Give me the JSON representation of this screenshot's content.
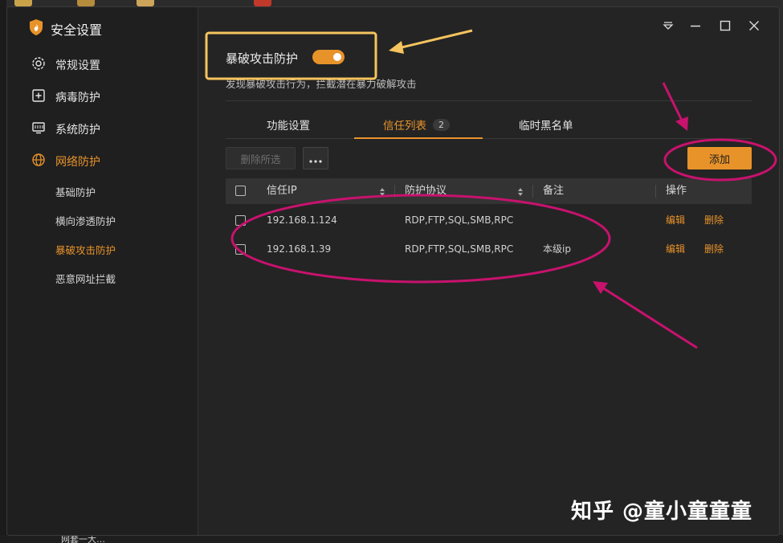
{
  "app": {
    "title": "安全设置"
  },
  "sidebar": {
    "items": [
      {
        "label": "常规设置",
        "icon": "gear-icon"
      },
      {
        "label": "病毒防护",
        "icon": "plus-square-icon"
      },
      {
        "label": "系统防护",
        "icon": "system-monitor-icon"
      },
      {
        "label": "网络防护",
        "icon": "globe-icon"
      }
    ],
    "subitems": [
      {
        "label": "基础防护"
      },
      {
        "label": "横向渗透防护"
      },
      {
        "label": "暴破攻击防护"
      },
      {
        "label": "恶意网址拦截"
      }
    ],
    "active_item": "网络防护",
    "active_subitem": "暴破攻击防护"
  },
  "feature": {
    "title": "暴破攻击防护",
    "description": "发现暴破攻击行为，拦截潜在暴力破解攻击",
    "enabled": true
  },
  "tabs": [
    {
      "label": "功能设置"
    },
    {
      "label": "信任列表",
      "badge": "2"
    },
    {
      "label": "临时黑名单"
    }
  ],
  "active_tab": "信任列表",
  "toolbar": {
    "delete_selected_label": "删除所选",
    "more_label": "···",
    "add_label": "添加"
  },
  "table": {
    "columns": [
      "信任IP",
      "防护协议",
      "备注",
      "操作"
    ],
    "rows": [
      {
        "ip": "192.168.1.124",
        "protocols": "RDP,FTP,SQL,SMB,RPC",
        "note": "",
        "edit": "编辑",
        "delete": "删除"
      },
      {
        "ip": "192.168.1.39",
        "protocols": "RDP,FTP,SQL,SMB,RPC",
        "note": "本级ip",
        "edit": "编辑",
        "delete": "删除"
      }
    ]
  },
  "desktop": {
    "taskbar_caption": "网套一大…"
  },
  "watermark": "知乎 @童小童童童",
  "colors": {
    "accent": "#e8932a",
    "annotation_yellow": "#f5c45e",
    "annotation_magenta": "#c8126e",
    "window_bg": "#242424",
    "sidebar_bg": "#1f1f1f"
  }
}
